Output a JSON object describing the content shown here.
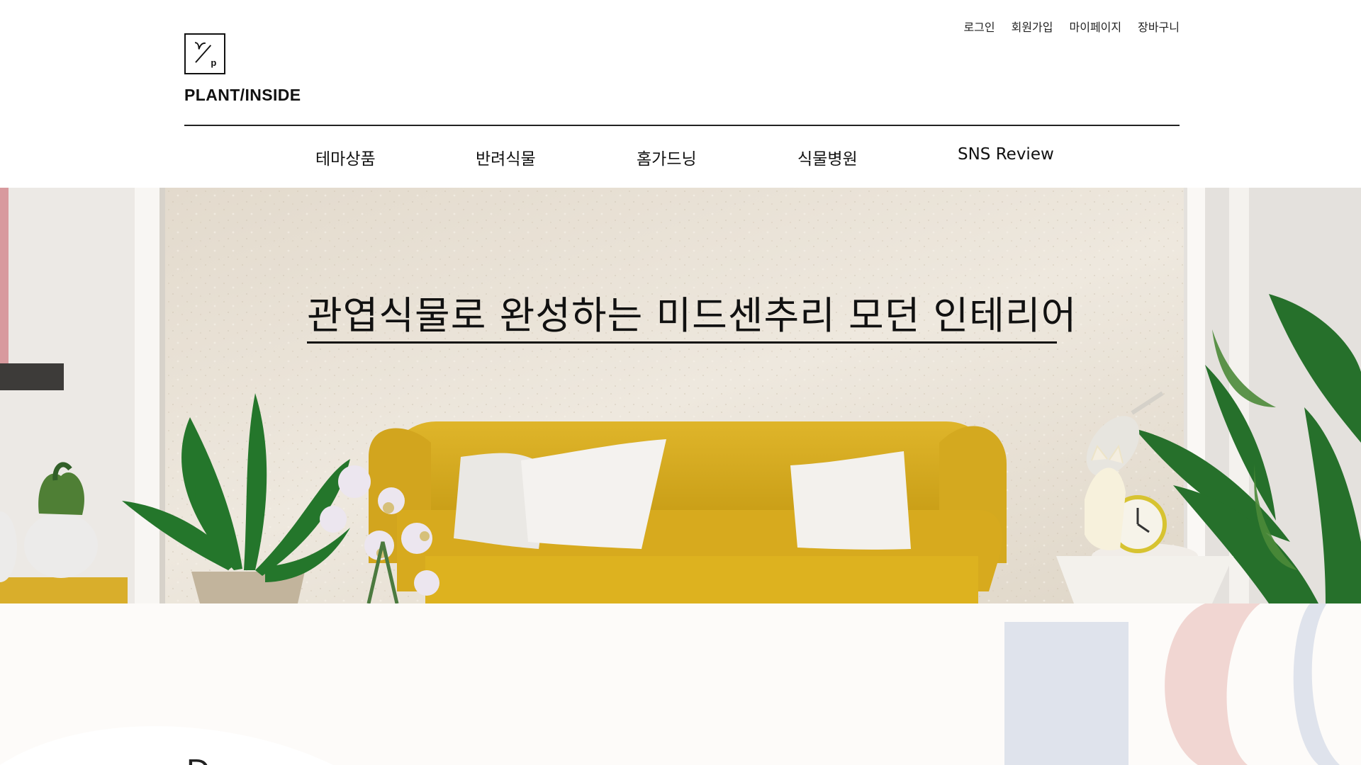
{
  "brand": {
    "name": "PLANT/INSIDE",
    "logo_mark": "γ/p"
  },
  "utility_nav": [
    {
      "label": "로그인"
    },
    {
      "label": "회원가입"
    },
    {
      "label": "마이페이지"
    },
    {
      "label": "장바구니"
    }
  ],
  "main_nav": [
    {
      "label": "테마상품"
    },
    {
      "label": "반려식물"
    },
    {
      "label": "홈가드닝"
    },
    {
      "label": "식물병원"
    },
    {
      "label": "SNS Review"
    }
  ],
  "hero": {
    "title": "관엽식물로 완성하는 미드센추리 모던 인테리어"
  },
  "colors": {
    "text": "#111111",
    "wall": "#e7dfd2",
    "sofa": "#d6ad23",
    "leaf": "#2f6e2c",
    "accent_blue": "#dfe4ee",
    "accent_pink": "#f0d5d1",
    "lower_bg": "#fdfbf9"
  },
  "icons": {
    "logo": "plant-inside-logo-icon"
  },
  "lower_section": {
    "peek_text": "D"
  }
}
